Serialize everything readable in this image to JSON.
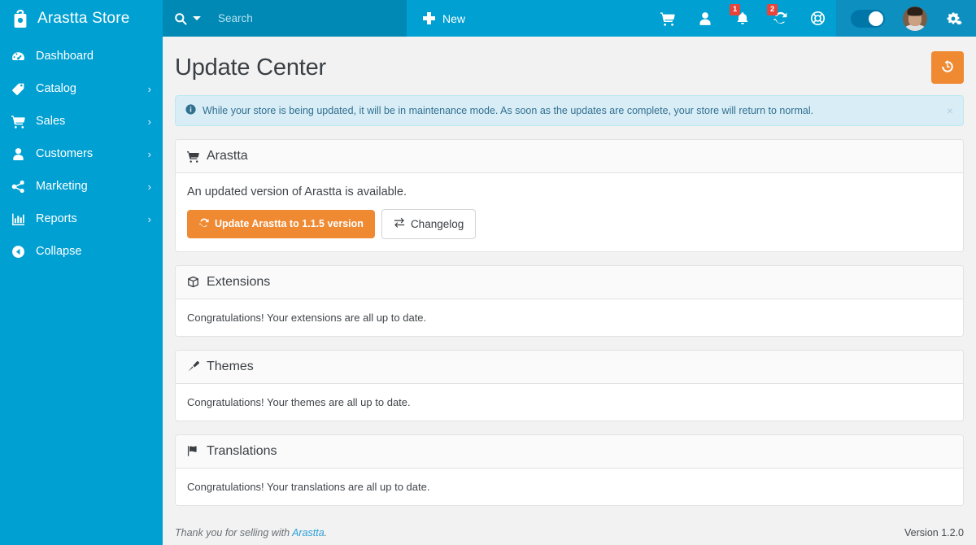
{
  "sidebar": {
    "brand": {
      "logo_icon": "arastta-bag-logo",
      "name": "Arastta Store"
    },
    "items": [
      {
        "label": "Dashboard",
        "icon": "dashboard-gauge-icon",
        "caret": ""
      },
      {
        "label": "Catalog",
        "icon": "tag-icon",
        "caret": "›"
      },
      {
        "label": "Sales",
        "icon": "cart-icon",
        "caret": "›"
      },
      {
        "label": "Customers",
        "icon": "user-icon",
        "caret": "›"
      },
      {
        "label": "Marketing",
        "icon": "share-icon",
        "caret": "›"
      },
      {
        "label": "Reports",
        "icon": "bar-chart-icon",
        "caret": "›"
      },
      {
        "label": "Collapse",
        "icon": "arrow-circle-left-icon",
        "caret": ""
      }
    ]
  },
  "topbar": {
    "search": {
      "icon": "search-icon",
      "dropdown_icon": "chevron-down-icon",
      "placeholder": "Search",
      "value": ""
    },
    "new": {
      "icon": "plus-icon",
      "label": "New"
    },
    "icons": [
      {
        "name": "cart-icon",
        "badge": ""
      },
      {
        "name": "user-icon",
        "badge": ""
      },
      {
        "name": "bell-icon",
        "badge": "1"
      },
      {
        "name": "refresh-icon",
        "badge": "2"
      },
      {
        "name": "lifebuoy-icon",
        "badge": ""
      }
    ],
    "toggle": {
      "name": "store-status-toggle",
      "state": "on"
    },
    "avatar": {
      "name": "user-avatar"
    },
    "settings": {
      "icon": "cogs-icon"
    }
  },
  "page": {
    "title": "Update Center",
    "history_button": {
      "icon": "history-rotate-left-icon",
      "label": ""
    }
  },
  "alert": {
    "icon": "info-circle-icon",
    "text": "While your store is being updated, it will be in maintenance mode. As soon as the updates are complete, your store will return to normal.",
    "close_label": "×"
  },
  "panels": [
    {
      "id": "arastta",
      "icon": "cart-icon",
      "title": "Arastta",
      "lead": "An updated version of Arastta is available.",
      "message": "",
      "buttons": [
        {
          "id": "update-arastta",
          "icon": "refresh-icon",
          "label": "Update Arastta to 1.1.5 version",
          "style": "orange"
        },
        {
          "id": "changelog",
          "icon": "exchange-icon",
          "label": "Changelog",
          "style": "default"
        }
      ]
    },
    {
      "id": "extensions",
      "icon": "cube-icon",
      "title": "Extensions",
      "lead": "",
      "message": "Congratulations! Your extensions are all up to date.",
      "buttons": []
    },
    {
      "id": "themes",
      "icon": "paintbrush-icon",
      "title": "Themes",
      "lead": "",
      "message": "Congratulations! Your themes are all up to date.",
      "buttons": []
    },
    {
      "id": "translations",
      "icon": "flag-icon",
      "title": "Translations",
      "lead": "",
      "message": "Congratulations! Your translations are all up to date.",
      "buttons": []
    }
  ],
  "footer": {
    "thanks_prefix": "Thank you for selling with ",
    "link_label": "Arastta",
    "thanks_suffix": ".",
    "version": "Version 1.2.0"
  },
  "colors": {
    "sidebar": "#00a0d2",
    "search_zone": "#0089b4",
    "topbar_right": "#0d8fc0",
    "accent_orange": "#ef8a33",
    "badge_red": "#e8443a",
    "alert_bg": "#d9edf7",
    "alert_border": "#bce8f1",
    "alert_text": "#31708f",
    "body_bg": "#f2f2f2",
    "link": "#2b9fd8"
  }
}
